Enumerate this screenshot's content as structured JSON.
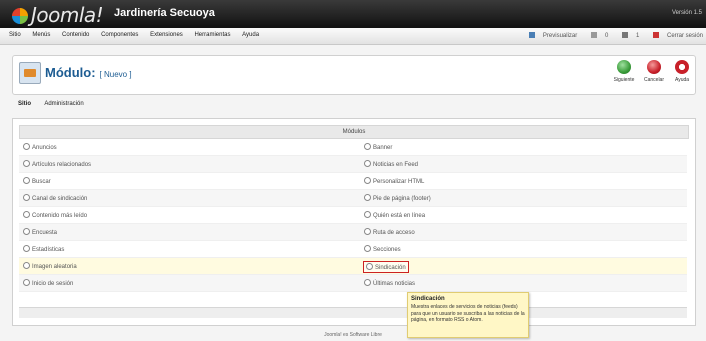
{
  "header": {
    "logo_text": "Joomla!",
    "site_title": "Jardinería Secuoya",
    "version": "Versión 1.5"
  },
  "menu": {
    "items": [
      "Sitio",
      "Menús",
      "Contenido",
      "Componentes",
      "Extensiones",
      "Herramientas",
      "Ayuda"
    ]
  },
  "status": {
    "preview": "Previsualizar",
    "messages": "0",
    "users": "1",
    "logout": "Cerrar sesión"
  },
  "toolbar": {
    "title": "Módulo:",
    "subtitle": "[ Nuevo ]",
    "buttons": [
      {
        "label": "Siguiente",
        "color": "#3a9c3a"
      },
      {
        "label": "Cancelar",
        "color": "#c8202a"
      },
      {
        "label": "Ayuda",
        "color": "#c8202a"
      }
    ]
  },
  "subtabs": [
    "Sitio",
    "Administración"
  ],
  "table": {
    "header": "Módulos",
    "rows": [
      {
        "left": "Anuncios",
        "right": "Banner"
      },
      {
        "left": "Artículos relacionados",
        "right": "Noticias en Feed"
      },
      {
        "left": "Buscar",
        "right": "Personalizar HTML"
      },
      {
        "left": "Canal de sindicación",
        "right": "Pie de página (footer)"
      },
      {
        "left": "Contenido más leído",
        "right": "Quién está en línea"
      },
      {
        "left": "Encuesta",
        "right": "Ruta de acceso"
      },
      {
        "left": "Estadísticas",
        "right": "Secciones"
      },
      {
        "left": "Imagen aleatoria",
        "right": "Sindicación"
      },
      {
        "left": "Inicio de sesión",
        "right": "Últimas noticias"
      }
    ]
  },
  "tooltip": {
    "title": "Sindicación",
    "body": "Muestra enlaces de servicios de noticias (feeds) para que un usuario se suscriba a las noticias de la página, en formato RSS o Atom."
  },
  "footer": "Joomla! es Software Libre"
}
